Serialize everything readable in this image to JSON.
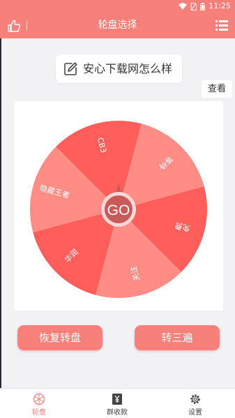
{
  "status_bar": {
    "time": "11:25"
  },
  "header": {
    "title": "轮盘选择"
  },
  "title_card": {
    "text": "安心下载网怎么样"
  },
  "view_button": "查看",
  "wheel": {
    "go_label": "GO",
    "segments": [
      "等待",
      "免费",
      "关注",
      "华润",
      "隐藏王者",
      "CB3"
    ],
    "colors": [
      "#ff8c85",
      "#ff5e5a",
      "#ff8c85",
      "#ff5e5a",
      "#ff8c85",
      "#ff5e5a"
    ]
  },
  "buttons": {
    "reset": "恢复转盘",
    "three_times": "转三遍"
  },
  "bottom_nav": {
    "items": [
      {
        "label": "轮盘",
        "active": true
      },
      {
        "label": "群收款",
        "active": false
      },
      {
        "label": "设置",
        "active": false
      }
    ]
  },
  "colors": {
    "primary": "#f8807b",
    "segment_dark": "#ff5e5a",
    "segment_light": "#ff8c85",
    "hub": "#c85a5a"
  }
}
